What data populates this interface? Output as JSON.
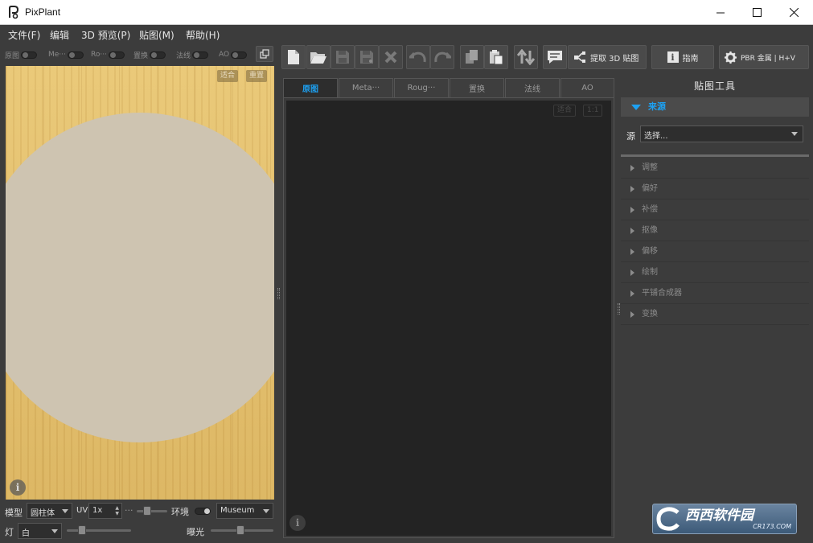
{
  "window": {
    "title": "PixPlant"
  },
  "menu": [
    "文件(F)",
    "编辑",
    "3D 预览(P)",
    "贴图(M)",
    "帮助(H)"
  ],
  "left_toggles": [
    {
      "label": "原图",
      "on": false
    },
    {
      "label": "Me···",
      "on": false
    },
    {
      "label": "Ro···",
      "on": false
    },
    {
      "label": "置换",
      "on": false
    },
    {
      "label": "法线",
      "on": false
    },
    {
      "label": "AO",
      "on": false
    }
  ],
  "viewport": {
    "fit_label": "适合",
    "reset_label": "重置"
  },
  "left_bottom": {
    "model_label": "模型",
    "model_value": "圆柱体",
    "uv_label": "UV",
    "uv_value": "1x",
    "ellipsis": "···",
    "env_label": "环境",
    "env_value": "Museum",
    "light_label": "灯",
    "light_value": "白",
    "exposure_label": "曝光"
  },
  "toolbar": {
    "buttons": [
      "new-file",
      "open-folder",
      "save",
      "save-as",
      "close",
      "undo",
      "redo",
      "copy",
      "paste",
      "swap",
      "comment"
    ],
    "extract_3d_label": "提取 3D 贴图",
    "guide_label": "指南",
    "pbr_label": "PBR 金属 | H+V"
  },
  "center": {
    "tabs": [
      "原图",
      "Meta···",
      "Roug···",
      "置换",
      "法线",
      "AO"
    ],
    "active_tab": 0,
    "fit_label": "适合",
    "one_to_one_label": "1:1"
  },
  "right_panel": {
    "title": "贴图工具",
    "source_section": "来源",
    "source_label": "源",
    "source_value": "选择...",
    "items": [
      "调整",
      "偏好",
      "补偿",
      "抠像",
      "偏移",
      "绘制",
      "平铺合成器",
      "变换"
    ]
  },
  "watermark": {
    "main": "西西软件园",
    "sub": "CR173.COM"
  },
  "colors": {
    "accent": "#1da1f2",
    "panel": "#3c3c3c",
    "viewport_dark": "#232323",
    "sphere": "#cec4b1",
    "wood": "#e4c06f"
  }
}
